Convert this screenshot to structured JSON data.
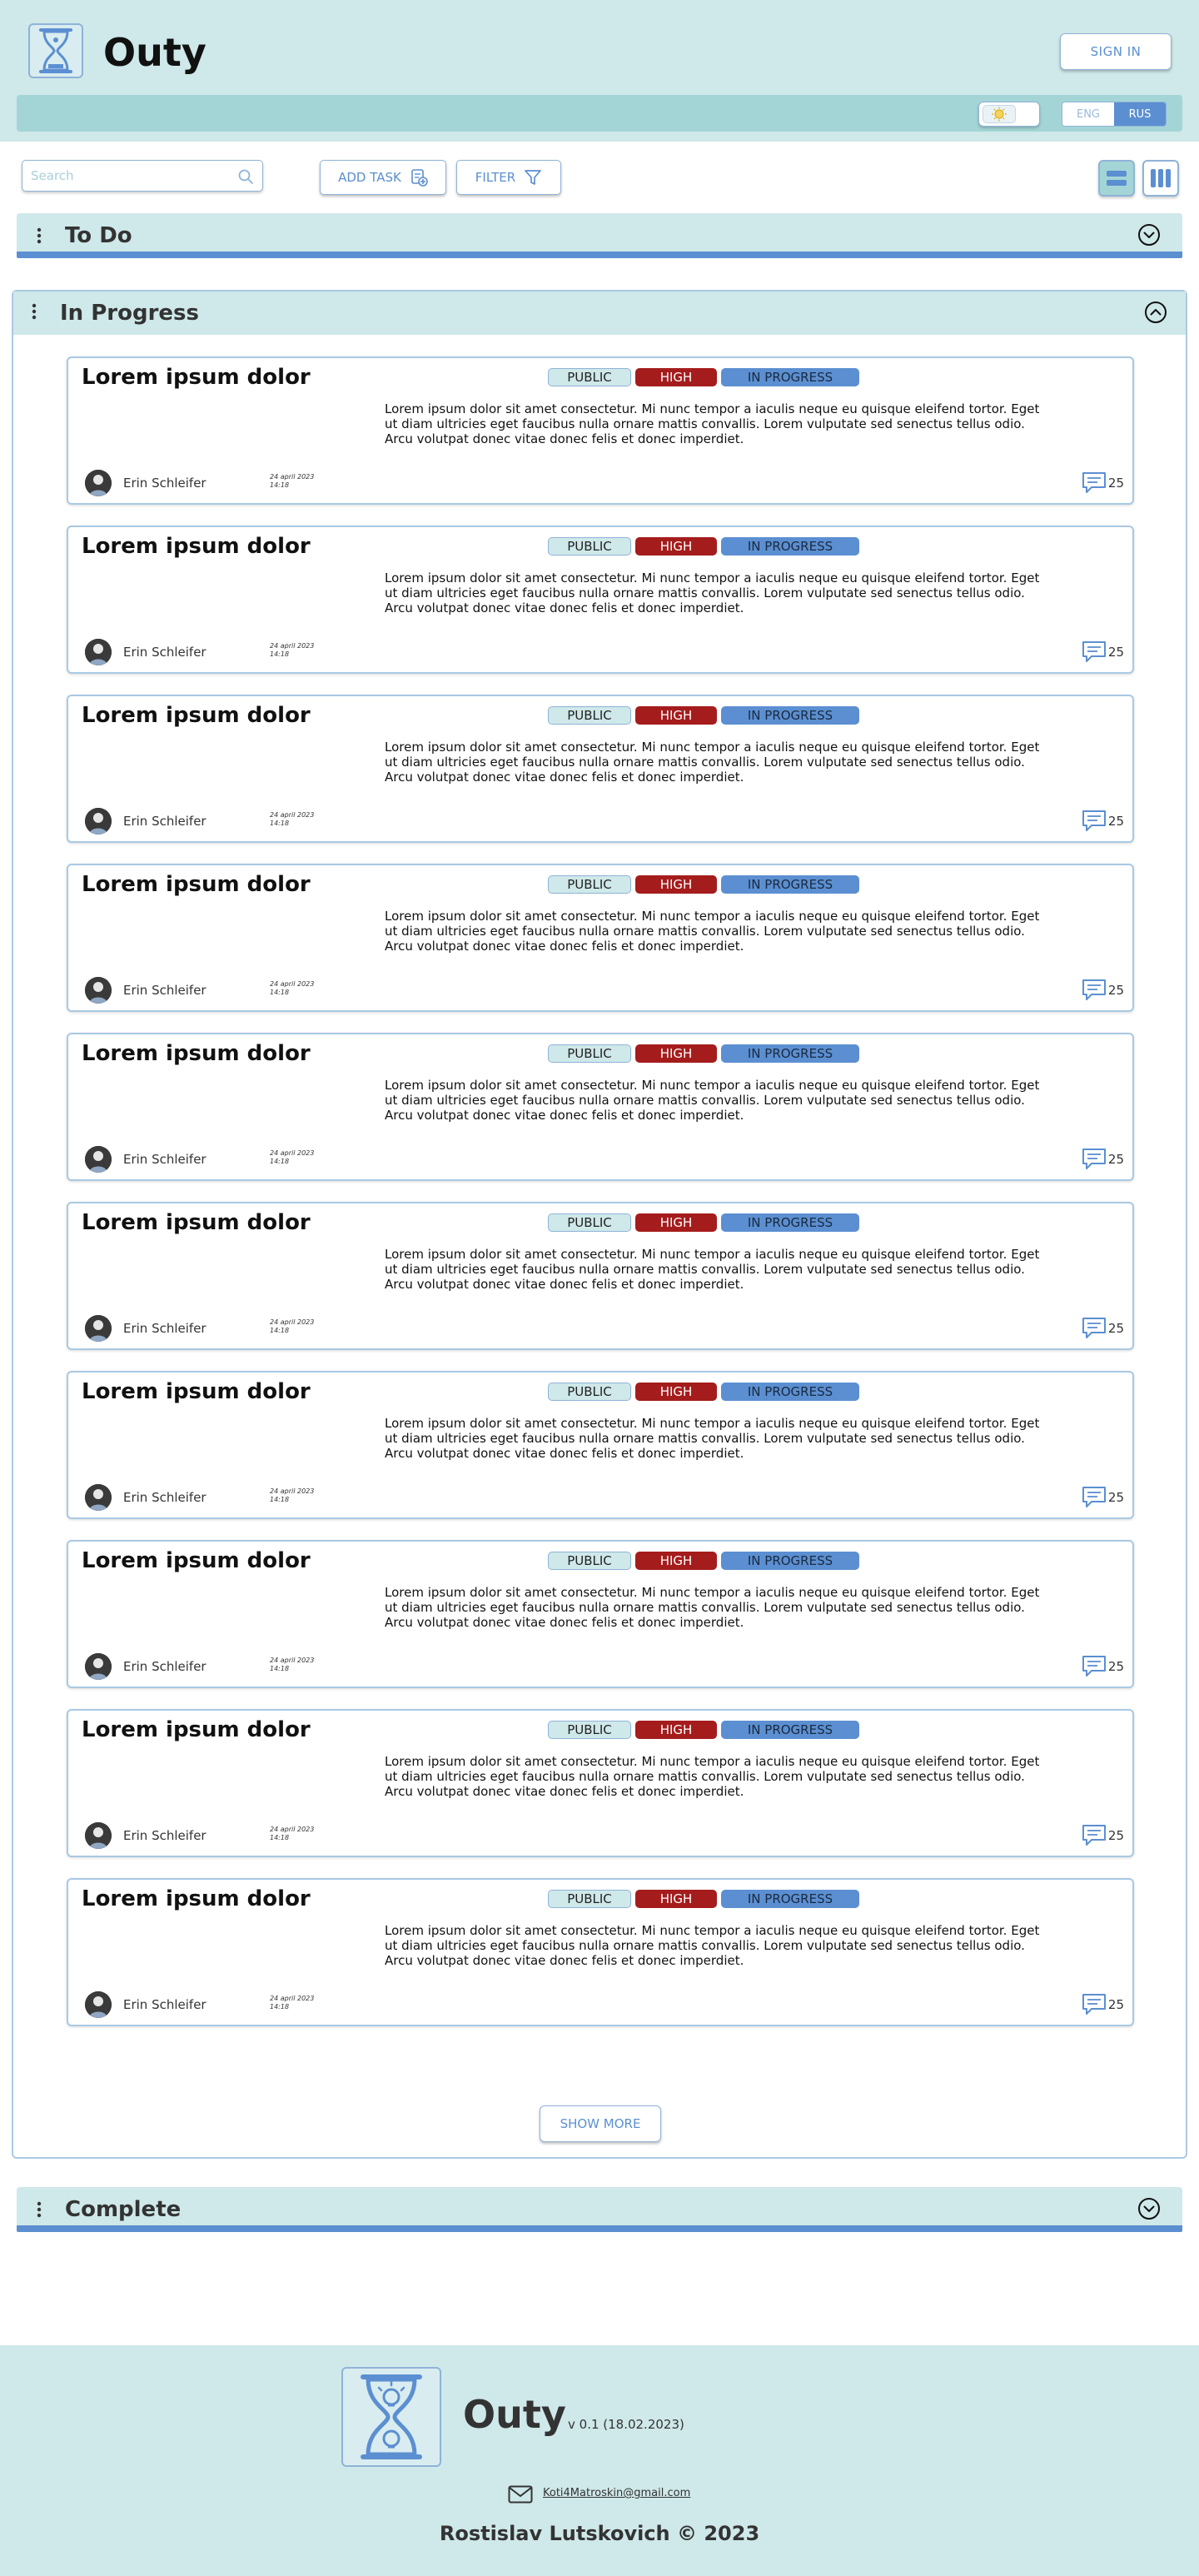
{
  "header": {
    "brand": "Outy",
    "signin_label": "SIGN IN",
    "lang_eng": "ENG",
    "lang_rus": "RUS"
  },
  "toolbar": {
    "search_placeholder": "Search",
    "add_task_label": "ADD TASK",
    "filter_label": "FILTER"
  },
  "sections": {
    "todo": "To Do",
    "in_progress": "In Progress",
    "complete": "Complete"
  },
  "cards": [
    {
      "title": "Lorem ipsum dolor",
      "visibility": "PUBLIC",
      "priority": "HIGH",
      "status": "IN PROGRESS",
      "description": "Lorem ipsum dolor sit amet consectetur. Mi nunc tempor a iaculis neque eu quisque eleifend tortor. Eget ut diam ultricies eget faucibus nulla ornare mattis convallis. Lorem vulputate sed senectus tellus odio. Arcu volutpat donec vitae donec felis et donec imperdiet.",
      "author": "Erin Schleifer",
      "date": "24 april 2023",
      "time": "14:18",
      "comments": "25"
    },
    {
      "title": "Lorem ipsum dolor",
      "visibility": "PUBLIC",
      "priority": "HIGH",
      "status": "IN PROGRESS",
      "description": "Lorem ipsum dolor sit amet consectetur. Mi nunc tempor a iaculis neque eu quisque eleifend tortor. Eget ut diam ultricies eget faucibus nulla ornare mattis convallis. Lorem vulputate sed senectus tellus odio. Arcu volutpat donec vitae donec felis et donec imperdiet.",
      "author": "Erin Schleifer",
      "date": "24 april 2023",
      "time": "14:18",
      "comments": "25"
    },
    {
      "title": "Lorem ipsum dolor",
      "visibility": "PUBLIC",
      "priority": "HIGH",
      "status": "IN PROGRESS",
      "description": "Lorem ipsum dolor sit amet consectetur. Mi nunc tempor a iaculis neque eu quisque eleifend tortor. Eget ut diam ultricies eget faucibus nulla ornare mattis convallis. Lorem vulputate sed senectus tellus odio. Arcu volutpat donec vitae donec felis et donec imperdiet.",
      "author": "Erin Schleifer",
      "date": "24 april 2023",
      "time": "14:18",
      "comments": "25"
    },
    {
      "title": "Lorem ipsum dolor",
      "visibility": "PUBLIC",
      "priority": "HIGH",
      "status": "IN PROGRESS",
      "description": "Lorem ipsum dolor sit amet consectetur. Mi nunc tempor a iaculis neque eu quisque eleifend tortor. Eget ut diam ultricies eget faucibus nulla ornare mattis convallis. Lorem vulputate sed senectus tellus odio. Arcu volutpat donec vitae donec felis et donec imperdiet.",
      "author": "Erin Schleifer",
      "date": "24 april 2023",
      "time": "14:18",
      "comments": "25"
    },
    {
      "title": "Lorem ipsum dolor",
      "visibility": "PUBLIC",
      "priority": "HIGH",
      "status": "IN PROGRESS",
      "description": "Lorem ipsum dolor sit amet consectetur. Mi nunc tempor a iaculis neque eu quisque eleifend tortor. Eget ut diam ultricies eget faucibus nulla ornare mattis convallis. Lorem vulputate sed senectus tellus odio. Arcu volutpat donec vitae donec felis et donec imperdiet.",
      "author": "Erin Schleifer",
      "date": "24 april 2023",
      "time": "14:18",
      "comments": "25"
    },
    {
      "title": "Lorem ipsum dolor",
      "visibility": "PUBLIC",
      "priority": "HIGH",
      "status": "IN PROGRESS",
      "description": "Lorem ipsum dolor sit amet consectetur. Mi nunc tempor a iaculis neque eu quisque eleifend tortor. Eget ut diam ultricies eget faucibus nulla ornare mattis convallis. Lorem vulputate sed senectus tellus odio. Arcu volutpat donec vitae donec felis et donec imperdiet.",
      "author": "Erin Schleifer",
      "date": "24 april 2023",
      "time": "14:18",
      "comments": "25"
    },
    {
      "title": "Lorem ipsum dolor",
      "visibility": "PUBLIC",
      "priority": "HIGH",
      "status": "IN PROGRESS",
      "description": "Lorem ipsum dolor sit amet consectetur. Mi nunc tempor a iaculis neque eu quisque eleifend tortor. Eget ut diam ultricies eget faucibus nulla ornare mattis convallis. Lorem vulputate sed senectus tellus odio. Arcu volutpat donec vitae donec felis et donec imperdiet.",
      "author": "Erin Schleifer",
      "date": "24 april 2023",
      "time": "14:18",
      "comments": "25"
    },
    {
      "title": "Lorem ipsum dolor",
      "visibility": "PUBLIC",
      "priority": "HIGH",
      "status": "IN PROGRESS",
      "description": "Lorem ipsum dolor sit amet consectetur. Mi nunc tempor a iaculis neque eu quisque eleifend tortor. Eget ut diam ultricies eget faucibus nulla ornare mattis convallis. Lorem vulputate sed senectus tellus odio. Arcu volutpat donec vitae donec felis et donec imperdiet.",
      "author": "Erin Schleifer",
      "date": "24 april 2023",
      "time": "14:18",
      "comments": "25"
    },
    {
      "title": "Lorem ipsum dolor",
      "visibility": "PUBLIC",
      "priority": "HIGH",
      "status": "IN PROGRESS",
      "description": "Lorem ipsum dolor sit amet consectetur. Mi nunc tempor a iaculis neque eu quisque eleifend tortor. Eget ut diam ultricies eget faucibus nulla ornare mattis convallis. Lorem vulputate sed senectus tellus odio. Arcu volutpat donec vitae donec felis et donec imperdiet.",
      "author": "Erin Schleifer",
      "date": "24 april 2023",
      "time": "14:18",
      "comments": "25"
    },
    {
      "title": "Lorem ipsum dolor",
      "visibility": "PUBLIC",
      "priority": "HIGH",
      "status": "IN PROGRESS",
      "description": "Lorem ipsum dolor sit amet consectetur. Mi nunc tempor a iaculis neque eu quisque eleifend tortor. Eget ut diam ultricies eget faucibus nulla ornare mattis convallis. Lorem vulputate sed senectus tellus odio. Arcu volutpat donec vitae donec felis et donec imperdiet.",
      "author": "Erin Schleifer",
      "date": "24 april 2023",
      "time": "14:18",
      "comments": "25"
    }
  ],
  "show_more_label": "SHOW MORE",
  "footer": {
    "brand": "Outy",
    "version": "v 0.1 (18.02.2023)",
    "email": "Koti4Matroskin@gmail.com",
    "copyright": "Rostislav Lutskovich © 2023"
  },
  "colors": {
    "accent": "#5b8fd1",
    "header_bg": "#cfe8e9",
    "subbar_bg": "#a4d5d6",
    "high_priority": "#a51c1c"
  },
  "icons": {
    "logo": "hourglass-icon",
    "search": "search-icon",
    "add_task": "add-task-icon",
    "filter": "filter-icon",
    "list_view": "list-view-icon",
    "board_view": "board-view-icon",
    "drag": "drag-handle-icon",
    "collapse": "chevron-icon",
    "comments": "comment-icon",
    "mail": "mail-icon",
    "theme": "sun-icon"
  }
}
